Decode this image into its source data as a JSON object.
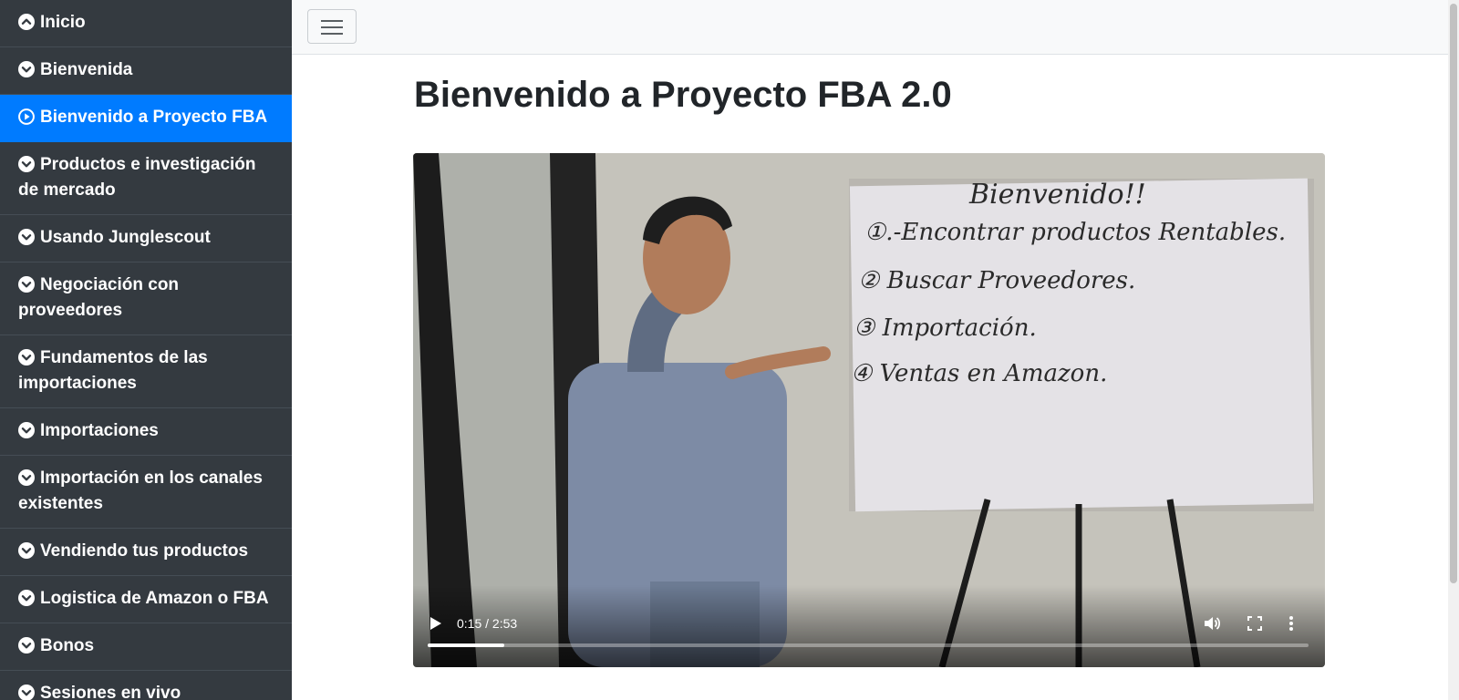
{
  "sidebar": {
    "items": [
      {
        "label": "Inicio",
        "icon": "chevron-up-circle-icon"
      },
      {
        "label": "Bienvenida",
        "icon": "chevron-down-circle-icon"
      },
      {
        "label": "Bienvenido a Proyecto FBA",
        "icon": "play-circle-icon",
        "active": true
      },
      {
        "label": "Productos e investigación de mercado",
        "icon": "chevron-down-circle-icon"
      },
      {
        "label": "Usando Junglescout",
        "icon": "chevron-down-circle-icon"
      },
      {
        "label": "Negociación con proveedores",
        "icon": "chevron-down-circle-icon"
      },
      {
        "label": "Fundamentos de las importaciones",
        "icon": "chevron-down-circle-icon"
      },
      {
        "label": "Importaciones",
        "icon": "chevron-down-circle-icon"
      },
      {
        "label": "Importación en los canales existentes",
        "icon": "chevron-down-circle-icon"
      },
      {
        "label": "Vendiendo tus productos",
        "icon": "chevron-down-circle-icon"
      },
      {
        "label": "Logistica de Amazon o FBA",
        "icon": "chevron-down-circle-icon"
      },
      {
        "label": "Bonos",
        "icon": "chevron-down-circle-icon"
      },
      {
        "label": "Sesiones en vivo",
        "icon": "chevron-down-circle-icon"
      }
    ]
  },
  "header": {
    "toggle_icon": "hamburger-menu-icon"
  },
  "main": {
    "title": "Bienvenido a Proyecto FBA 2.0"
  },
  "video": {
    "current_time": "0:15",
    "duration": "2:53",
    "time_text": "0:15 / 2:53",
    "progress_fraction": 0.087,
    "whiteboard": {
      "heading": "Bienvenido!!",
      "lines": [
        "①.-Encontrar productos Rentables.",
        "② Buscar Proveedores.",
        "③ Importación.",
        "④ Ventas en Amazon."
      ]
    }
  },
  "colors": {
    "sidebar_bg": "#343a40",
    "active_bg": "#007bff",
    "topbar_bg": "#f8f9fa"
  }
}
